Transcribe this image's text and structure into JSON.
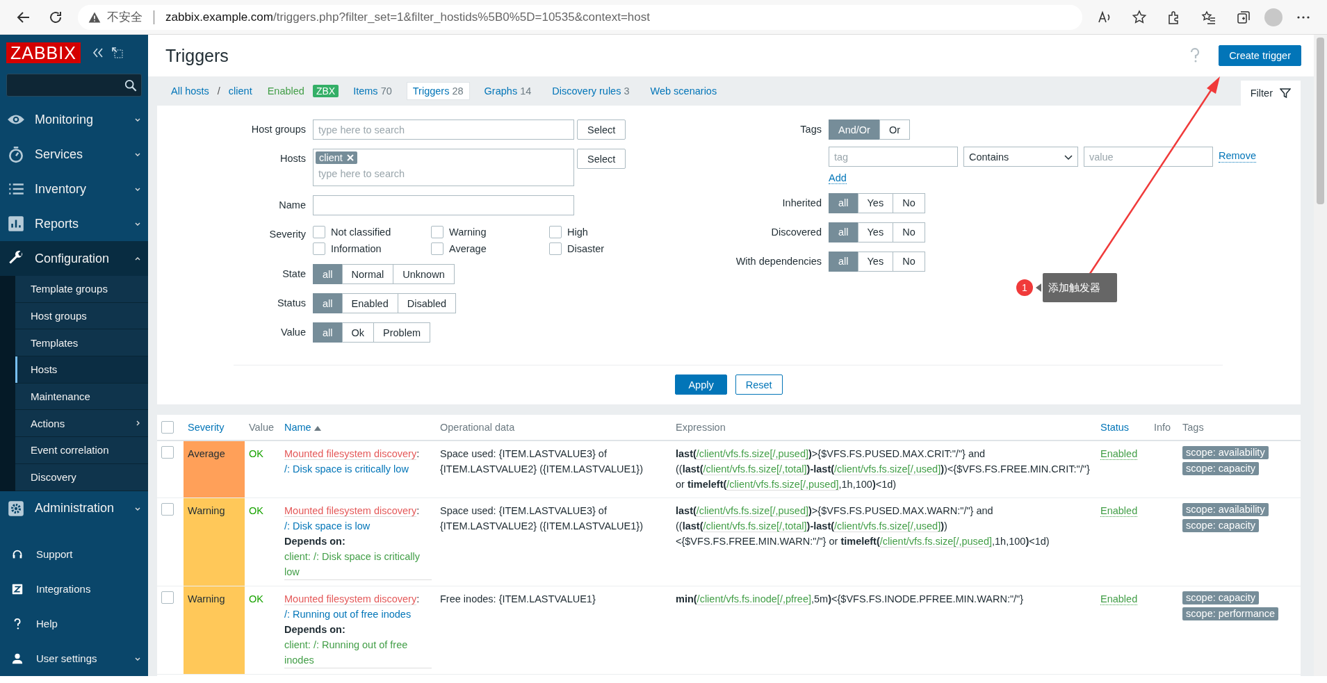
{
  "browser": {
    "security_label": "不安全",
    "url_host": "zabbix.example.com",
    "url_path": "/triggers.php?filter_set=1&filter_hostids%5B0%5D=10535&context=host"
  },
  "sidebar": {
    "logo": "ZABBIX",
    "menu": [
      {
        "label": "Monitoring",
        "expanded": false
      },
      {
        "label": "Services",
        "expanded": false
      },
      {
        "label": "Inventory",
        "expanded": false
      },
      {
        "label": "Reports",
        "expanded": false
      },
      {
        "label": "Configuration",
        "expanded": true,
        "children": [
          {
            "label": "Template groups",
            "selected": false,
            "kind": "link"
          },
          {
            "label": "Host groups",
            "selected": false,
            "kind": "link"
          },
          {
            "label": "Templates",
            "selected": false,
            "kind": "link"
          },
          {
            "label": "Hosts",
            "selected": true,
            "kind": "link"
          },
          {
            "label": "Maintenance",
            "selected": false,
            "kind": "link"
          },
          {
            "label": "Actions",
            "selected": false,
            "kind": "submenu"
          },
          {
            "label": "Event correlation",
            "selected": false,
            "kind": "link"
          },
          {
            "label": "Discovery",
            "selected": false,
            "kind": "link"
          }
        ]
      },
      {
        "label": "Administration",
        "expanded": false
      }
    ],
    "footer": [
      {
        "label": "Support",
        "kind": "link"
      },
      {
        "label": "Integrations",
        "kind": "link"
      },
      {
        "label": "Help",
        "kind": "link"
      },
      {
        "label": "User settings",
        "kind": "menu"
      }
    ]
  },
  "header": {
    "title": "Triggers",
    "create_button": "Create trigger"
  },
  "nav": {
    "breadcrumbs": [
      "All hosts",
      "client"
    ],
    "separator": "/",
    "status": "Enabled",
    "badge": "ZBX",
    "tabs": [
      {
        "label": "Items",
        "count": "70",
        "selected": false
      },
      {
        "label": "Triggers",
        "count": "28",
        "selected": true
      },
      {
        "label": "Graphs",
        "count": "14",
        "selected": false
      },
      {
        "label": "Discovery rules",
        "count": "3",
        "selected": false
      },
      {
        "label": "Web scenarios",
        "selected": false
      }
    ],
    "filter_tab": {
      "label": "Filter",
      "selected": true
    }
  },
  "filter": {
    "host_groups": {
      "label": "Host groups",
      "placeholder": "type here to search",
      "button": "Select"
    },
    "hosts": {
      "label": "Hosts",
      "chips": [
        "client"
      ],
      "placeholder": "type here to search",
      "button": "Select"
    },
    "name": {
      "label": "Name"
    },
    "severity": {
      "label": "Severity",
      "options": [
        {
          "label": "Not classified",
          "checked": false
        },
        {
          "label": "Warning",
          "checked": false
        },
        {
          "label": "High",
          "checked": false
        },
        {
          "label": "Information",
          "checked": false
        },
        {
          "label": "Average",
          "checked": false
        },
        {
          "label": "Disaster",
          "checked": false
        }
      ]
    },
    "left_segments": [
      {
        "label": "State",
        "options": [
          {
            "label": "all",
            "selected": true
          },
          {
            "label": "Normal",
            "selected": false
          },
          {
            "label": "Unknown",
            "selected": false
          }
        ]
      },
      {
        "label": "Status",
        "options": [
          {
            "label": "all",
            "selected": true
          },
          {
            "label": "Enabled",
            "selected": false
          },
          {
            "label": "Disabled",
            "selected": false
          }
        ]
      },
      {
        "label": "Value",
        "options": [
          {
            "label": "all",
            "selected": true
          },
          {
            "label": "Ok",
            "selected": false
          },
          {
            "label": "Problem",
            "selected": false
          }
        ]
      }
    ],
    "tags": {
      "label": "Tags",
      "options": [
        {
          "label": "And/Or",
          "selected": true
        },
        {
          "label": "Or",
          "selected": false
        }
      ],
      "tag_placeholder": "tag",
      "operator": "Contains",
      "value_placeholder": "value",
      "remove": "Remove",
      "add": "Add"
    },
    "right_segments": [
      {
        "label": "Inherited",
        "options": [
          {
            "label": "all",
            "selected": true
          },
          {
            "label": "Yes",
            "selected": false
          },
          {
            "label": "No",
            "selected": false
          }
        ]
      },
      {
        "label": "Discovered",
        "options": [
          {
            "label": "all",
            "selected": true
          },
          {
            "label": "Yes",
            "selected": false
          },
          {
            "label": "No",
            "selected": false
          }
        ]
      },
      {
        "label": "With dependencies",
        "options": [
          {
            "label": "all",
            "selected": true
          },
          {
            "label": "Yes",
            "selected": false
          },
          {
            "label": "No",
            "selected": false
          }
        ]
      }
    ],
    "apply": "Apply",
    "reset": "Reset"
  },
  "annotation": {
    "badge": "1",
    "text": "添加触发器"
  },
  "table": {
    "select_all_checked": false,
    "columns": [
      {
        "label": "Severity",
        "sortable": true,
        "sorted": false
      },
      {
        "label": "Value",
        "sortable": false,
        "sorted": false
      },
      {
        "label": "Name",
        "sortable": true,
        "sorted": true
      },
      {
        "label": "Operational data",
        "sortable": false,
        "sorted": false
      },
      {
        "label": "Expression",
        "sortable": false,
        "sorted": false
      },
      {
        "label": "Status",
        "sortable": true,
        "sorted": false
      },
      {
        "label": "Info",
        "sortable": false,
        "sorted": false
      },
      {
        "label": "Tags",
        "sortable": false,
        "sorted": false
      }
    ],
    "rows": [
      {
        "checked": false,
        "severity": "Average",
        "color": "#ffa059",
        "value": "OK",
        "name_prefix": "Mounted filesystem discovery",
        "name_separator": ":",
        "name": "/: Disk space is critically low",
        "operational_data": "Space used: {ITEM.LASTVALUE3} of {ITEM.LASTVALUE2} ({ITEM.LASTVALUE1})",
        "expression": [
          {
            "kind": "func",
            "text": "last("
          },
          {
            "kind": "item",
            "text": "/client/vfs.fs.size[/,pused]"
          },
          {
            "kind": "func",
            "text": ")"
          },
          {
            "kind": "text",
            "text": ">{$VFS.FS.PUSED.MAX.CRIT:\"/\"} and (("
          },
          {
            "kind": "func",
            "text": "last("
          },
          {
            "kind": "item",
            "text": "/client/vfs.fs.size[/,total]"
          },
          {
            "kind": "func",
            "text": ")-last("
          },
          {
            "kind": "item",
            "text": "/client/vfs.fs.size[/,used]"
          },
          {
            "kind": "func",
            "text": ")"
          },
          {
            "kind": "text",
            "text": ")<{$VFS.FS.FREE.MIN.CRIT:\"/\"} or "
          },
          {
            "kind": "func",
            "text": "timeleft("
          },
          {
            "kind": "item",
            "text": "/client/vfs.fs.size[/,pused]"
          },
          {
            "kind": "text",
            "text": ",1h,100"
          },
          {
            "kind": "func",
            "text": ")"
          },
          {
            "kind": "text",
            "text": "<1d)"
          }
        ],
        "status": "Enabled",
        "tags": [
          "scope: availability",
          "scope: capacity"
        ]
      },
      {
        "checked": false,
        "severity": "Warning",
        "color": "#ffc859",
        "value": "OK",
        "name_prefix": "Mounted filesystem discovery",
        "name_separator": ":",
        "name": "/: Disk space is low",
        "depends_label": "Depends on:",
        "depends_on": "client: /: Disk space is critically low",
        "operational_data": "Space used: {ITEM.LASTVALUE3} of {ITEM.LASTVALUE2} ({ITEM.LASTVALUE1})",
        "expression": [
          {
            "kind": "func",
            "text": "last("
          },
          {
            "kind": "item",
            "text": "/client/vfs.fs.size[/,pused]"
          },
          {
            "kind": "func",
            "text": ")"
          },
          {
            "kind": "text",
            "text": ">{$VFS.FS.PUSED.MAX.WARN:\"/\"} and (("
          },
          {
            "kind": "func",
            "text": "last("
          },
          {
            "kind": "item",
            "text": "/client/vfs.fs.size[/,total]"
          },
          {
            "kind": "func",
            "text": ")-last("
          },
          {
            "kind": "item",
            "text": "/client/vfs.fs.size[/,used]"
          },
          {
            "kind": "func",
            "text": ")"
          },
          {
            "kind": "text",
            "text": ")<{$VFS.FS.FREE.MIN.WARN:\"/\"} or "
          },
          {
            "kind": "func",
            "text": "timeleft"
          },
          {
            "kind": "func",
            "text": "("
          },
          {
            "kind": "item",
            "text": "/client/vfs.fs.size[/,pused]"
          },
          {
            "kind": "text",
            "text": ",1h,100"
          },
          {
            "kind": "func",
            "text": ")"
          },
          {
            "kind": "text",
            "text": "<1d)"
          }
        ],
        "status": "Enabled",
        "tags": [
          "scope: availability",
          "scope: capacity"
        ]
      },
      {
        "checked": false,
        "severity": "Warning",
        "color": "#ffc859",
        "value": "OK",
        "name_prefix": "Mounted filesystem discovery",
        "name_separator": ":",
        "name": "/: Running out of free inodes",
        "depends_label": "Depends on:",
        "depends_on": "client: /: Running out of free inodes",
        "operational_data": "Free inodes: {ITEM.LASTVALUE1}",
        "expression": [
          {
            "kind": "func",
            "text": "min("
          },
          {
            "kind": "item",
            "text": "/client/vfs.fs.inode[/,pfree]"
          },
          {
            "kind": "text",
            "text": ",5m"
          },
          {
            "kind": "func",
            "text": ")"
          },
          {
            "kind": "text",
            "text": "<{$VFS.FS.INODE.PFREE.MIN.WARN:\"/\"}"
          }
        ],
        "status": "Enabled",
        "tags": [
          "scope: capacity",
          "scope: performance"
        ]
      }
    ]
  }
}
